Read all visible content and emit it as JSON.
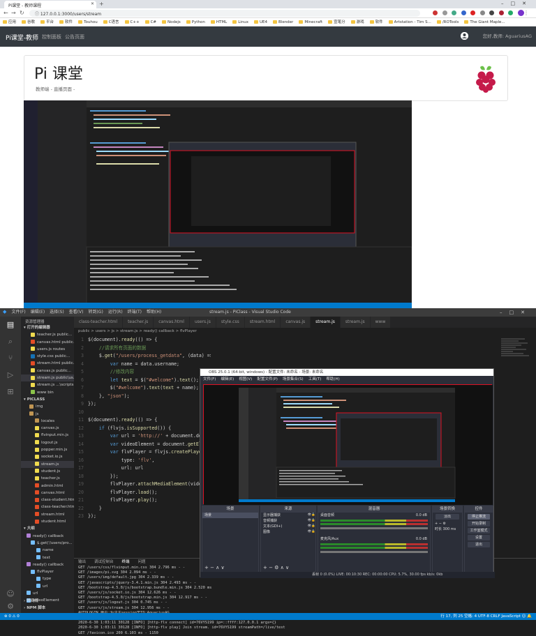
{
  "browser": {
    "tab_title": "Pi课堂 - 教师课程",
    "url": "127.0.0.1:3000/users/stream",
    "bookmarks": [
      "应用",
      "谷歌",
      "平台",
      "软件",
      "Touhou",
      "C语言",
      "C++",
      "C#",
      "Nodejs",
      "Python",
      "HTML",
      "Linux",
      "UE4",
      "Blender",
      "Minecraft",
      "宣笔分",
      "游戏",
      "软件",
      "Artstation - Tim S...",
      "/ROTools",
      "The Giant Maple..."
    ]
  },
  "site": {
    "brand": "Pi课堂-教师",
    "nav": [
      "控制面板",
      "公告页面"
    ],
    "user": "您好,教师: AguariusAG",
    "heading": "Pi 课堂",
    "subheading": "教师端 - 直播页面 -",
    "colors": {
      "navbar": "#343a40",
      "raspberry": "#c51a4a",
      "leaf": "#6cc04a"
    }
  },
  "vscode": {
    "menu": [
      "文件(F)",
      "编辑(E)",
      "选择(S)",
      "查看(V)",
      "转到(G)",
      "运行(R)",
      "终端(T)",
      "帮助(H)"
    ],
    "title": "stream.js - PiClass - Visual Studio Code",
    "tabs": [
      "class-teacher.html",
      "teacher.js",
      "canvas.html",
      "users.js",
      "style.css",
      "stream.html",
      "canvas.js",
      "stream.js",
      "stream.js",
      "www"
    ],
    "active_tab": "stream.js ...\\js",
    "breadcrumb": "public > users > js > stream.js > ready() callback > flvPlayer",
    "sidebar_title": "资源管理器",
    "open_editors": "打开的编辑器",
    "open_files": [
      "teacher.js public...",
      "canvas.html public...",
      "users.js routes",
      "style.css public...",
      "stream.html public...",
      "canvas.js public...",
      "stream.js public\\us...",
      "stream.js ...\\scripts",
      "www bin"
    ],
    "project": "PICLASS",
    "tree": [
      "img",
      "js",
      "locales",
      "canvas.js",
      "flvinput.min.js",
      "logout.js",
      "popper.min.js",
      "socket.io.js",
      "stream.js",
      "student.js",
      "teacher.js",
      "admin.html",
      "canvas.html",
      "class-student.html",
      "class-teacher.html",
      "stream.html",
      "student.html"
    ],
    "outline_title": "大纲",
    "outline": [
      "ready() callback",
      "$.get('/users/pro...",
      "name",
      "text",
      "ready() callback",
      "flvPlayer",
      "type",
      "url",
      "url",
      "videoElement"
    ],
    "timeline": "时间线",
    "npm": "NPM 脚本",
    "code": [
      "$(document).ready(() => {",
      "    //请求所有页面的数据",
      "    $.get(\"/users/process_getdata\", (data) => {",
      "        var name = data.username;",
      "        //修改内容",
      "        let text = $(\"#welcome\").text();",
      "        $(\"#welcome\").text(text + name);",
      "    }, \"json\");",
      "});",
      "",
      "$(document).ready(() => {",
      "    if (flvjs.isSupported()) {",
      "        var url = 'http://' + document.domain + ':8000/live/test.flv';",
      "        var videoElement = document.getElementById('videoElement');",
      "        var flvPlayer = flvjs.createPlayer({",
      "            type: 'flv',",
      "            url: url",
      "        });",
      "        flvPlayer.attachMediaElement(videoElement);",
      "        flvPlayer.load();",
      "        flvPlayer.play();",
      "    }",
      "});"
    ],
    "terminal_tabs": [
      "输出",
      "调试控制台",
      "终端",
      "问题"
    ],
    "terminal": [
      "GET /users/css/flvinput.min.css 304 2.796 ms - -",
      "GET /images/pi.svg 304 2.094 ms - -",
      "GET /users/img/default.jpg 304 2.339 ms - -",
      "GET /javascripts/jquery-3.4.1.min.js 304 2.493 ms - -",
      "GET /bootstrap-4.5.0/js/bootstrap.bundle.min.js 304 2.520 ms",
      "GET /users/js/socket.io.js 304 12.626 ms - -",
      "GET /bootstrap-4.5.0/js/bootstrap.min.js 304 12.917 ms - -",
      "GET /users/js/logout.js 304 0.745 ms - -",
      "GET /users/js/stream.js 304 12.956 ms - -",
      "AUTOLOGIN 用户:为注注session里ID:AguariusAG",
      "GET /users/process_getdata 304 1.593 ms - -",
      "2020-6-30 1:03:11 30128 [INFO] [http-flv connect] id=76VYS199 ip=::ffff:127.0.0.1 args={}",
      "2020-6-30 1:03:11 30128 [INFO] [http-flv play] Join stream. id=76VYS199 streamPath=/live/test",
      "GET /favicon.ico 200 6.103 ms - 1150"
    ],
    "status_left": "⊗ 0 ⚠ 0",
    "status_right": "行 17, 列 25  空格: 4  UTF-8  CRLF  JavaScript  ☺ 🔔"
  },
  "obs": {
    "title": "OBS 25.0.1 (64-bit, windows) - 配置文件: 未命名 - 场景: 未命名",
    "menu": [
      "文件(F)",
      "编辑(E)",
      "视图(V)",
      "配置文件(P)",
      "场景集合(S)",
      "工具(T)",
      "帮助(H)"
    ],
    "docks": [
      "场景",
      "来源",
      "混音器",
      "场景转换",
      "控件"
    ],
    "scene": "场景",
    "sources": [
      "显示器捕获",
      "音频捕获",
      "文本(GDI+)",
      "图像"
    ],
    "mixer": [
      {
        "name": "桌面音频",
        "db": "0.0 dB"
      },
      {
        "name": "麦克风/Aux",
        "db": "0.0 dB"
      }
    ],
    "transition": "淡出",
    "duration_label": "时长",
    "duration": "300 ms",
    "controls": [
      "停止推流",
      "开始录制",
      "工作室模式",
      "设置",
      "退出"
    ],
    "status": "丢帧 0 (0.0%)    LIVE: 00:10:30    REC: 00:00:00    CPU: 5.7%, 30.00 fps    kb/s: 0kb"
  }
}
